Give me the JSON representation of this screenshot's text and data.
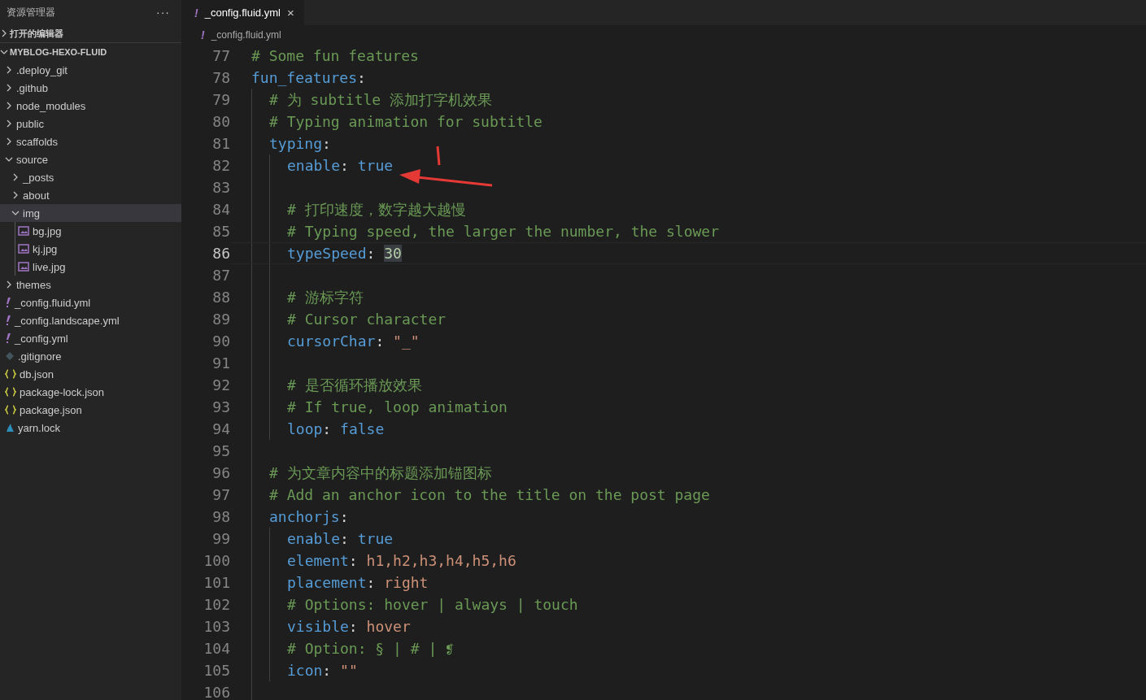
{
  "sidebar": {
    "title": "资源管理器",
    "more": "···",
    "sections": [
      {
        "label": "打开的编辑器",
        "expanded": false
      },
      {
        "label": "MYBLOG-HEXO-FLUID",
        "expanded": true
      }
    ],
    "tree": [
      {
        "name": ".deploy_git",
        "kind": "folder",
        "expanded": false,
        "selected": false
      },
      {
        "name": ".github",
        "kind": "folder",
        "expanded": false,
        "selected": false
      },
      {
        "name": "node_modules",
        "kind": "folder",
        "expanded": false,
        "selected": false
      },
      {
        "name": "public",
        "kind": "folder",
        "expanded": false,
        "selected": false
      },
      {
        "name": "scaffolds",
        "kind": "folder",
        "expanded": false,
        "selected": false
      },
      {
        "name": "source",
        "kind": "folder",
        "expanded": true,
        "selected": false,
        "children": [
          {
            "name": "_posts",
            "kind": "folder",
            "expanded": false,
            "selected": false
          },
          {
            "name": "about",
            "kind": "folder",
            "expanded": false,
            "selected": false
          },
          {
            "name": "img",
            "kind": "folder",
            "expanded": true,
            "selected": true,
            "children": [
              {
                "name": "bg.jpg",
                "kind": "image",
                "selected": false
              },
              {
                "name": "kj.jpg",
                "kind": "image",
                "selected": false
              },
              {
                "name": "live.jpg",
                "kind": "image",
                "selected": false
              }
            ]
          }
        ]
      },
      {
        "name": "themes",
        "kind": "folder",
        "expanded": false,
        "selected": false
      },
      {
        "name": "_config.fluid.yml",
        "kind": "yaml",
        "selected": false
      },
      {
        "name": "_config.landscape.yml",
        "kind": "yaml",
        "selected": false
      },
      {
        "name": "_config.yml",
        "kind": "yaml",
        "selected": false
      },
      {
        "name": ".gitignore",
        "kind": "git",
        "selected": false
      },
      {
        "name": "db.json",
        "kind": "json",
        "selected": false
      },
      {
        "name": "package-lock.json",
        "kind": "json",
        "selected": false
      },
      {
        "name": "package.json",
        "kind": "json",
        "selected": false
      },
      {
        "name": "yarn.lock",
        "kind": "yarn",
        "selected": false
      }
    ]
  },
  "tabs": [
    {
      "icon": "!",
      "label": "_config.fluid.yml",
      "close": "×",
      "selected": true
    }
  ],
  "breadcrumb": {
    "icon": "!",
    "label": "_config.fluid.yml"
  },
  "editor": {
    "lines": [
      {
        "number": "77",
        "current": false,
        "tokens": [
          {
            "kind": "comment",
            "text": "# Some fun features"
          }
        ]
      },
      {
        "number": "78",
        "current": false,
        "tokens": [
          {
            "kind": "key",
            "text": "fun_features"
          },
          {
            "kind": "punct",
            "text": ":"
          }
        ],
        "children": [
          {
            "number": "79",
            "current": false,
            "tokens": [
              {
                "kind": "comment",
                "text": "# 为 subtitle 添加打字机效果"
              }
            ]
          },
          {
            "number": "80",
            "current": false,
            "tokens": [
              {
                "kind": "comment",
                "text": "# Typing animation for subtitle"
              }
            ]
          },
          {
            "number": "81",
            "current": false,
            "tokens": [
              {
                "kind": "key",
                "text": "typing"
              },
              {
                "kind": "punct",
                "text": ":"
              }
            ],
            "children": [
              {
                "number": "82",
                "current": false,
                "tokens": [
                  {
                    "kind": "key",
                    "text": "enable"
                  },
                  {
                    "kind": "punct",
                    "text": ": "
                  },
                  {
                    "kind": "keyword",
                    "text": "true"
                  }
                ]
              },
              {
                "number": "83",
                "current": false
              },
              {
                "number": "84",
                "current": false,
                "tokens": [
                  {
                    "kind": "comment",
                    "text": "# 打印速度，数字越大越慢"
                  }
                ]
              },
              {
                "number": "85",
                "current": false,
                "tokens": [
                  {
                    "kind": "comment",
                    "text": "# Typing speed, the larger the number, the slower"
                  }
                ]
              },
              {
                "number": "86",
                "current": true,
                "tokens": [
                  {
                    "kind": "key",
                    "text": "typeSpeed"
                  },
                  {
                    "kind": "punct",
                    "text": ": "
                  },
                  {
                    "kind": "number",
                    "text": "30",
                    "highlighted": true
                  }
                ]
              },
              {
                "number": "87",
                "current": false
              },
              {
                "number": "88",
                "current": false,
                "tokens": [
                  {
                    "kind": "comment",
                    "text": "# 游标字符"
                  }
                ]
              },
              {
                "number": "89",
                "current": false,
                "tokens": [
                  {
                    "kind": "comment",
                    "text": "# Cursor character"
                  }
                ]
              },
              {
                "number": "90",
                "current": false,
                "tokens": [
                  {
                    "kind": "key",
                    "text": "cursorChar"
                  },
                  {
                    "kind": "punct",
                    "text": ": "
                  },
                  {
                    "kind": "string",
                    "text": "\"_\""
                  }
                ]
              },
              {
                "number": "91",
                "current": false
              },
              {
                "number": "92",
                "current": false,
                "tokens": [
                  {
                    "kind": "comment",
                    "text": "# 是否循环播放效果"
                  }
                ]
              },
              {
                "number": "93",
                "current": false,
                "tokens": [
                  {
                    "kind": "comment",
                    "text": "# If true, loop animation"
                  }
                ]
              },
              {
                "number": "94",
                "current": false,
                "tokens": [
                  {
                    "kind": "key",
                    "text": "loop"
                  },
                  {
                    "kind": "punct",
                    "text": ": "
                  },
                  {
                    "kind": "keyword",
                    "text": "false"
                  }
                ]
              }
            ]
          },
          {
            "number": "95",
            "current": false
          },
          {
            "number": "96",
            "current": false,
            "tokens": [
              {
                "kind": "comment",
                "text": "# 为文章内容中的标题添加锚图标"
              }
            ]
          },
          {
            "number": "97",
            "current": false,
            "tokens": [
              {
                "kind": "comment",
                "text": "# Add an anchor icon to the title on the post page"
              }
            ]
          },
          {
            "number": "98",
            "current": false,
            "tokens": [
              {
                "kind": "key",
                "text": "anchorjs"
              },
              {
                "kind": "punct",
                "text": ":"
              }
            ],
            "children": [
              {
                "number": "99",
                "current": false,
                "tokens": [
                  {
                    "kind": "key",
                    "text": "enable"
                  },
                  {
                    "kind": "punct",
                    "text": ": "
                  },
                  {
                    "kind": "keyword",
                    "text": "true"
                  }
                ]
              },
              {
                "number": "100",
                "current": false,
                "tokens": [
                  {
                    "kind": "key",
                    "text": "element"
                  },
                  {
                    "kind": "punct",
                    "text": ": "
                  },
                  {
                    "kind": "string",
                    "text": "h1,h2,h3,h4,h5,h6"
                  }
                ]
              },
              {
                "number": "101",
                "current": false,
                "tokens": [
                  {
                    "kind": "key",
                    "text": "placement"
                  },
                  {
                    "kind": "punct",
                    "text": ": "
                  },
                  {
                    "kind": "string",
                    "text": "right"
                  }
                ]
              },
              {
                "number": "102",
                "current": false,
                "tokens": [
                  {
                    "kind": "comment",
                    "text": "# Options: hover | always | touch"
                  }
                ]
              },
              {
                "number": "103",
                "current": false,
                "tokens": [
                  {
                    "kind": "key",
                    "text": "visible"
                  },
                  {
                    "kind": "punct",
                    "text": ": "
                  },
                  {
                    "kind": "string",
                    "text": "hover"
                  }
                ]
              },
              {
                "number": "104",
                "current": false,
                "tokens": [
                  {
                    "kind": "comment",
                    "text": "# Option: § | # | ❡"
                  }
                ]
              },
              {
                "number": "105",
                "current": false,
                "tokens": [
                  {
                    "kind": "key",
                    "text": "icon"
                  },
                  {
                    "kind": "punct",
                    "text": ": "
                  },
                  {
                    "kind": "string",
                    "text": "\"\""
                  }
                ]
              }
            ]
          },
          {
            "number": "106",
            "current": false
          }
        ]
      }
    ]
  }
}
